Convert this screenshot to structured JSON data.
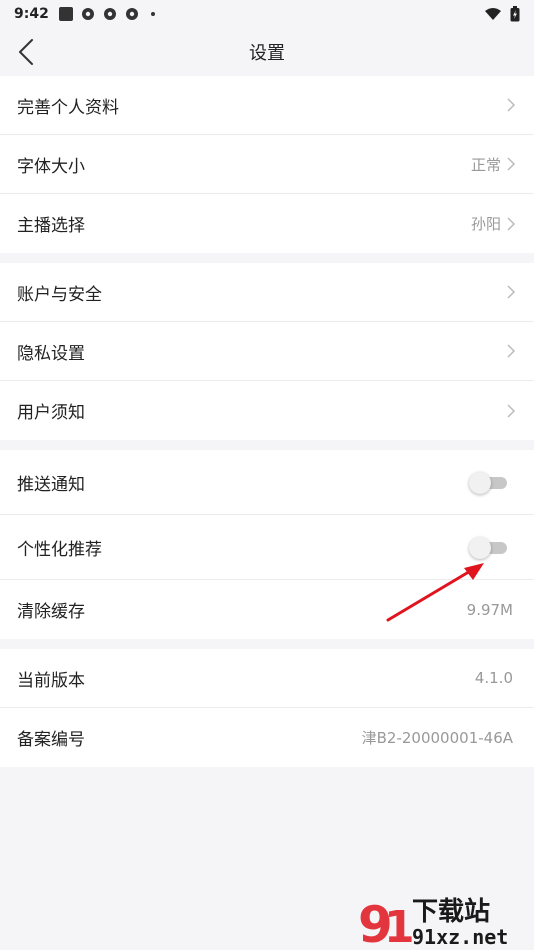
{
  "statusbar": {
    "time": "9:42"
  },
  "nav": {
    "title": "设置"
  },
  "group1": [
    {
      "label": "完善个人资料",
      "value": ""
    },
    {
      "label": "字体大小",
      "value": "正常"
    },
    {
      "label": "主播选择",
      "value": "孙阳"
    }
  ],
  "group2": [
    {
      "label": "账户与安全"
    },
    {
      "label": "隐私设置"
    },
    {
      "label": "用户须知"
    }
  ],
  "group3": {
    "push": {
      "label": "推送通知",
      "on": false
    },
    "recommend": {
      "label": "个性化推荐",
      "on": false
    },
    "cache": {
      "label": "清除缓存",
      "value": "9.97M"
    }
  },
  "group4": {
    "version": {
      "label": "当前版本",
      "value": "4.1.0"
    },
    "icp": {
      "label": "备案编号",
      "value": "津B2-20000001-46A"
    }
  },
  "colors": {
    "background": "#f5f5f7",
    "arrow": "#e0141e",
    "toggle_track": "#c7c7c7"
  },
  "watermark": {
    "brand": "下载站",
    "domain": "91xz.net"
  }
}
